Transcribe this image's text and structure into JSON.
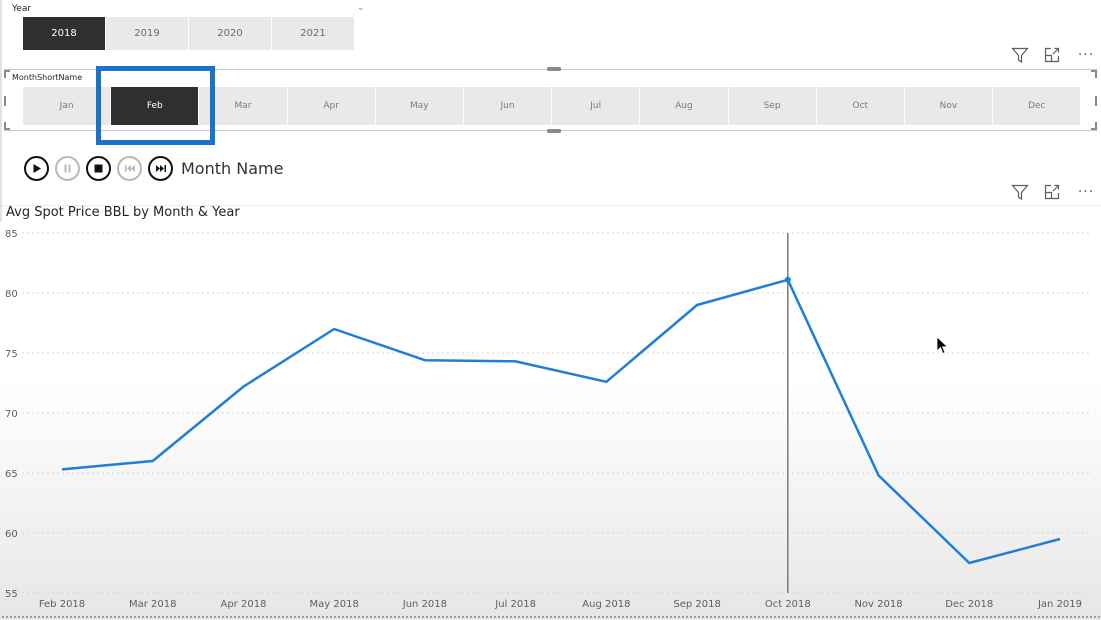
{
  "year_slicer": {
    "label": "Year",
    "options": [
      "2018",
      "2019",
      "2020",
      "2021"
    ],
    "selected": "2018"
  },
  "month_slicer": {
    "label": "MonthShortName",
    "options": [
      "Jan",
      "Feb",
      "Mar",
      "Apr",
      "May",
      "Jun",
      "Jul",
      "Aug",
      "Sep",
      "Oct",
      "Nov",
      "Dec"
    ],
    "selected": "Feb",
    "highlight_color": "#1a73c8"
  },
  "visual_header": {
    "filter_icon": "filter-icon",
    "focus_icon": "focus-mode-icon",
    "more_label": "···"
  },
  "play_axis": {
    "buttons": [
      "play",
      "pause",
      "stop",
      "previous",
      "next"
    ],
    "disabled": [
      "pause",
      "previous"
    ],
    "label": "Month Name"
  },
  "chart_data": {
    "type": "line",
    "title": "Avg Spot Price BBL by Month & Year",
    "xlabel": "",
    "ylabel": "",
    "categories": [
      "Feb 2018",
      "Mar 2018",
      "Apr 2018",
      "May 2018",
      "Jun 2018",
      "Jul 2018",
      "Aug 2018",
      "Sep 2018",
      "Oct 2018",
      "Nov 2018",
      "Dec 2018",
      "Jan 2019"
    ],
    "series": [
      {
        "name": "Avg Spot Price BBL",
        "color": "#1f7fd4",
        "values": [
          65.3,
          66.0,
          72.2,
          77.0,
          74.4,
          74.3,
          72.6,
          79.0,
          81.1,
          64.8,
          57.5,
          59.5
        ]
      }
    ],
    "ylim": [
      55,
      85
    ],
    "yticks": [
      55,
      60,
      65,
      70,
      75,
      80,
      85
    ],
    "grid": true,
    "reference_line_category": "Oct 2018",
    "highlighted_point": "Oct 2018"
  }
}
